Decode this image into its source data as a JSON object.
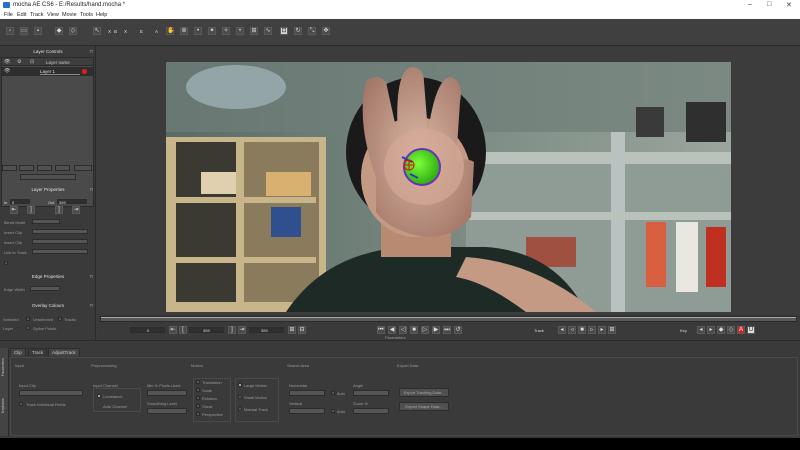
{
  "window": {
    "title": "mocha AE CS6 - E:/Results/hand.mocha *",
    "controls": [
      "–",
      "□",
      "✕"
    ]
  },
  "menu": [
    "File",
    "Edit",
    "Track",
    "View",
    "Movie",
    "Tools",
    "Help"
  ],
  "toolbar": {
    "tools": [
      "X",
      "B",
      "X",
      "E",
      "A"
    ],
    "layer_select": "hand",
    "zoom_select": "Full",
    "mattes_label": "Mattes",
    "overlays_label": "Overlays",
    "view_value": "0.5",
    "stabilize_label": "Stabilize",
    "track_label": "Track",
    "preview_label": "Preview",
    "colors": {
      "red": "#e02020",
      "magenta": "#c020c0"
    }
  },
  "left_panel": {
    "layer_controls_title": "Layer Controls",
    "layer_name_header": "Layer name",
    "layers": [
      {
        "name": "Layer 1",
        "color": "#e02020"
      }
    ],
    "layer_properties_title": "Layer Properties",
    "in_label": "In",
    "in_value": "0",
    "out_label": "Out",
    "out_value": "359",
    "props": [
      "Blend Mode",
      "Insert Clip",
      "Insert Clip",
      "Link to Track"
    ],
    "edge_properties_title": "Edge Properties",
    "edge_width_label": "Edge Width",
    "overlay_colours_title": "Overlay Colours",
    "overlay_labels": [
      "Selected",
      "Unselected",
      "Tracks",
      "Layer",
      "Spline Points"
    ]
  },
  "timeline": {
    "start_frame": "0",
    "current_frame": "359",
    "end_frame": "359",
    "track_label": "Track",
    "key_label": "Key",
    "parameters_label": "Parameters"
  },
  "bottom_panel": {
    "tabs": [
      "Clip",
      "Track",
      "AdjustTrack"
    ],
    "side_tabs": [
      "Parameters",
      "Keyframe"
    ],
    "groups": [
      "Input",
      "Preprocessing",
      "Motion",
      "Search Area",
      "Export Data"
    ],
    "input_clip_label": "Input Clip",
    "track_individual_fields": "Track Individual Fields",
    "input_channel_label": "Input Channel",
    "luminance_label": "Luminance",
    "auto_channel_label": "Auto Channel",
    "min_pct_label": "Min % Pixels Used",
    "smoothing_label": "Smoothing Level",
    "motion_options": [
      "Translation",
      "Scale",
      "Rotation",
      "Shear",
      "Perspective"
    ],
    "large_motion": "Large Motion",
    "small_motion": "Small Motion",
    "manual_track": "Manual Track",
    "horizontal_label": "Horizontal",
    "vertical_label": "Vertical",
    "angle_label": "Angle",
    "zoom_label": "Zoom %",
    "auto_label": "Auto",
    "export_tracking": "Export Tracking Data...",
    "export_shape": "Export Shape Data..."
  }
}
